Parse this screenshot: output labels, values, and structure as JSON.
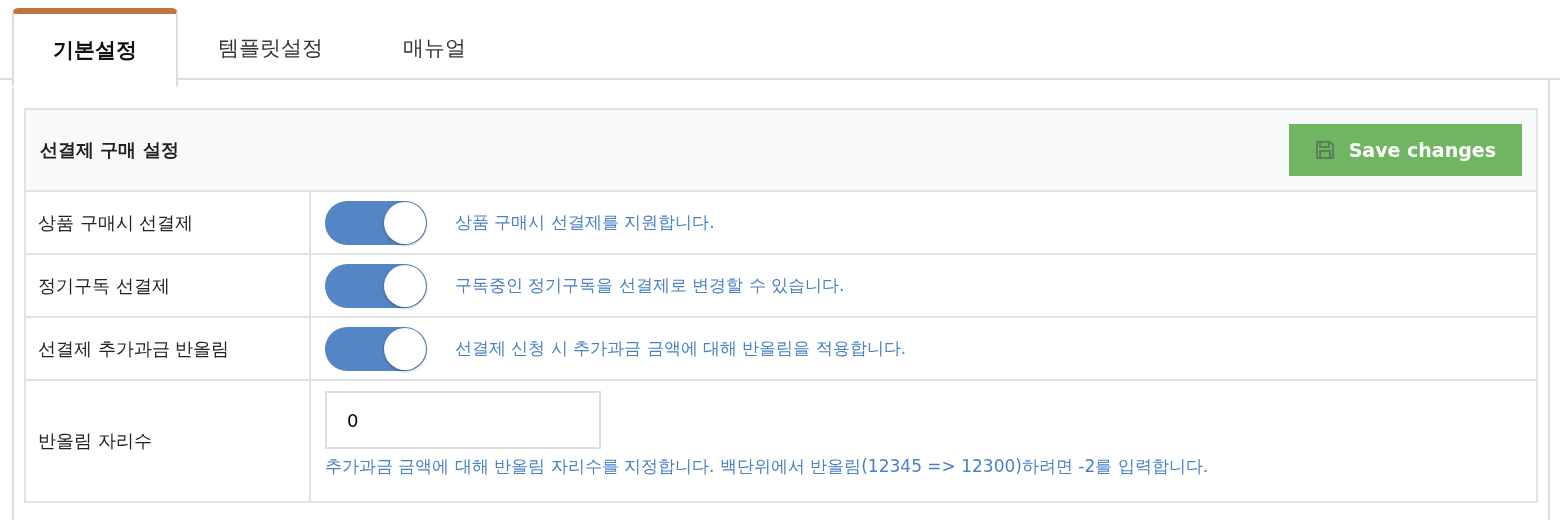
{
  "tabs": [
    {
      "label": "기본설정",
      "selected": true
    },
    {
      "label": "템플릿설정",
      "selected": false
    },
    {
      "label": "매뉴얼",
      "selected": false
    }
  ],
  "panel": {
    "title": "선결제 구매 설정",
    "save_button": "Save changes"
  },
  "rows": [
    {
      "kind": "toggle",
      "label": "상품 구매시 선결제",
      "on": true,
      "help": "상품 구매시 선결제를 지원합니다."
    },
    {
      "kind": "toggle",
      "label": "정기구독 선결제",
      "on": true,
      "help": "구독중인 정기구독을 선결제로 변경할 수 있습니다."
    },
    {
      "kind": "toggle",
      "label": "선결제 추가과금 반올림",
      "on": true,
      "help": "선결제 신청 시 추가과금 금액에 대해 반올림을 적용합니다."
    },
    {
      "kind": "input",
      "label": "반올림 자리수",
      "value": "0",
      "help": "추가과금 금액에 대해 반올림 자리수를 지정합니다. 백단위에서 반올림(12345 => 12300)하려면 -2를 입력합니다."
    }
  ]
}
